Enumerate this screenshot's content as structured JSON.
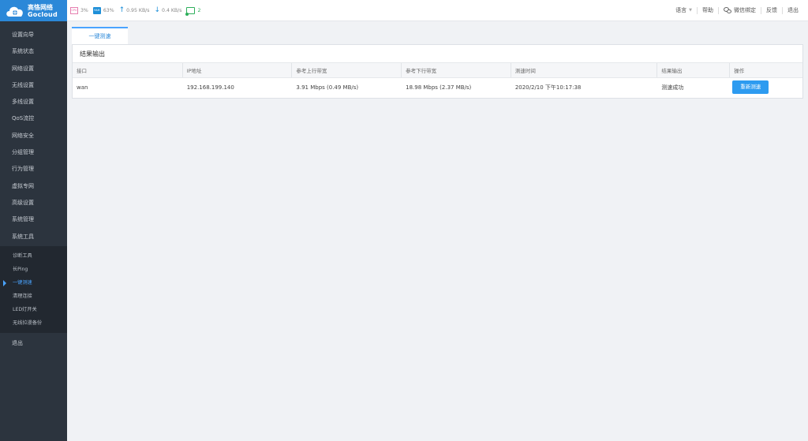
{
  "logo": {
    "cn": "高恪网络",
    "en": "Gocloud"
  },
  "topbar": {
    "cpu_badge": "CPU",
    "cpu_value": "3%",
    "ram_badge": "RAM",
    "ram_value": "63%",
    "upload_speed": "0.95 KB/s",
    "download_speed": "0.4 KB/s",
    "online_count": "2",
    "links": {
      "language": "语言",
      "help": "帮助",
      "wechat_bind": "微信绑定",
      "feedback": "反馈",
      "logout": "退出"
    }
  },
  "sidebar": {
    "items": [
      "设置向导",
      "系统状态",
      "网络设置",
      "无线设置",
      "多线设置",
      "QoS流控",
      "网络安全",
      "分组管理",
      "行为管理",
      "虚拟专网",
      "高级设置",
      "系统管理",
      "系统工具"
    ],
    "sub_items": [
      "诊断工具",
      "长Ping",
      "一键测速",
      "清理连接",
      "LED灯开关",
      "无线拉漫备份"
    ],
    "active_sub": "一键测速",
    "logout": "退出"
  },
  "main": {
    "tab": "一键测速",
    "panel_title": "结果输出",
    "columns": [
      "接口",
      "IP地址",
      "参考上行带宽",
      "参考下行带宽",
      "测速时间",
      "结果输出",
      "操作"
    ],
    "rows": [
      {
        "interface": "wan",
        "ip": "192.168.199.140",
        "up": "3.91 Mbps (0.49 MB/s)",
        "down": "18.98 Mbps (2.37 MB/s)",
        "time": "2020/2/10 下午10:17:38",
        "result": "测速成功",
        "action": "重新测速"
      }
    ]
  }
}
